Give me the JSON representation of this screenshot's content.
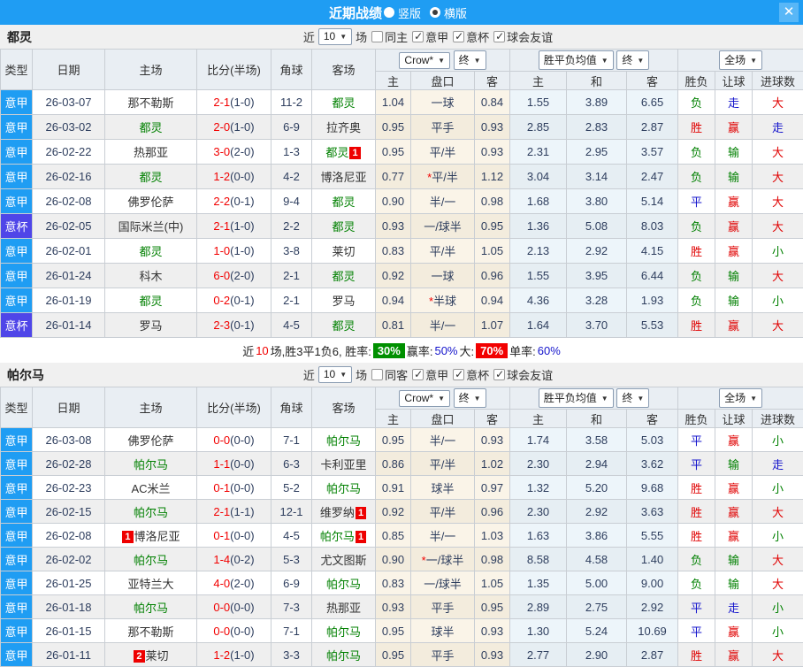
{
  "title_bar": {
    "title": "近期战绩",
    "radio_vertical": "竖版",
    "radio_horizontal": "横版",
    "close": "✕"
  },
  "columns": {
    "type": "类型",
    "date": "日期",
    "home": "主场",
    "score": "比分(半场)",
    "corner": "角球",
    "away": "客场",
    "odds_home": "主",
    "handicap": "盘口",
    "odds_away": "客",
    "mean_home": "主",
    "mean_draw": "和",
    "mean_away": "客",
    "result": "胜负",
    "let_ball": "让球",
    "goals": "进球数"
  },
  "sections": [
    {
      "team": "都灵",
      "filter": {
        "near": "近",
        "count": "10",
        "games": "场",
        "same": "同主",
        "checks": [
          "意甲",
          "意杯",
          "球会友谊"
        ]
      },
      "dropdowns": {
        "bookmaker": "Crow*",
        "final1": "终",
        "mean": "胜平负均值",
        "final2": "终",
        "scope": "全场"
      },
      "rows": [
        {
          "league": "意甲",
          "date": "26-03-07",
          "home": "那不勒斯",
          "home_green": false,
          "home_card": "",
          "score": "2-1",
          "half": "(1-0)",
          "corner": "11-2",
          "away": "都灵",
          "away_green": true,
          "away_card": "",
          "odds_home": "1.04",
          "handicap_star": "",
          "handicap": "一球",
          "odds_away": "0.84",
          "mean_home": "1.55",
          "mean_draw": "3.89",
          "mean_away": "6.65",
          "result": "负",
          "let_ball": "走",
          "goals": "大"
        },
        {
          "league": "意甲",
          "date": "26-03-02",
          "home": "都灵",
          "home_green": true,
          "home_card": "",
          "score": "2-0",
          "half": "(1-0)",
          "corner": "6-9",
          "away": "拉齐奥",
          "away_green": false,
          "away_card": "",
          "odds_home": "0.95",
          "handicap_star": "",
          "handicap": "平手",
          "odds_away": "0.93",
          "mean_home": "2.85",
          "mean_draw": "2.83",
          "mean_away": "2.87",
          "result": "胜",
          "let_ball": "赢",
          "goals": "走"
        },
        {
          "league": "意甲",
          "date": "26-02-22",
          "home": "热那亚",
          "home_green": false,
          "home_card": "",
          "score": "3-0",
          "half": "(2-0)",
          "corner": "1-3",
          "away": "都灵",
          "away_green": true,
          "away_card": "1",
          "odds_home": "0.95",
          "handicap_star": "",
          "handicap": "平/半",
          "odds_away": "0.93",
          "mean_home": "2.31",
          "mean_draw": "2.95",
          "mean_away": "3.57",
          "result": "负",
          "let_ball": "输",
          "goals": "大"
        },
        {
          "league": "意甲",
          "date": "26-02-16",
          "home": "都灵",
          "home_green": true,
          "home_card": "",
          "score": "1-2",
          "half": "(0-0)",
          "corner": "4-2",
          "away": "博洛尼亚",
          "away_green": false,
          "away_card": "",
          "odds_home": "0.77",
          "handicap_star": "*",
          "handicap": "平/半",
          "odds_away": "1.12",
          "mean_home": "3.04",
          "mean_draw": "3.14",
          "mean_away": "2.47",
          "result": "负",
          "let_ball": "输",
          "goals": "大"
        },
        {
          "league": "意甲",
          "date": "26-02-08",
          "home": "佛罗伦萨",
          "home_green": false,
          "home_card": "",
          "score": "2-2",
          "half": "(0-1)",
          "corner": "9-4",
          "away": "都灵",
          "away_green": true,
          "away_card": "",
          "odds_home": "0.90",
          "handicap_star": "",
          "handicap": "半/一",
          "odds_away": "0.98",
          "mean_home": "1.68",
          "mean_draw": "3.80",
          "mean_away": "5.14",
          "result": "平",
          "let_ball": "赢",
          "goals": "大"
        },
        {
          "league": "意杯",
          "date": "26-02-05",
          "home": "国际米兰(中)",
          "home_green": false,
          "home_card": "",
          "score": "2-1",
          "half": "(1-0)",
          "corner": "2-2",
          "away": "都灵",
          "away_green": true,
          "away_card": "",
          "odds_home": "0.93",
          "handicap_star": "",
          "handicap": "一/球半",
          "odds_away": "0.95",
          "mean_home": "1.36",
          "mean_draw": "5.08",
          "mean_away": "8.03",
          "result": "负",
          "let_ball": "赢",
          "goals": "大"
        },
        {
          "league": "意甲",
          "date": "26-02-01",
          "home": "都灵",
          "home_green": true,
          "home_card": "",
          "score": "1-0",
          "half": "(1-0)",
          "corner": "3-8",
          "away": "莱切",
          "away_green": false,
          "away_card": "",
          "odds_home": "0.83",
          "handicap_star": "",
          "handicap": "平/半",
          "odds_away": "1.05",
          "mean_home": "2.13",
          "mean_draw": "2.92",
          "mean_away": "4.15",
          "result": "胜",
          "let_ball": "赢",
          "goals": "小"
        },
        {
          "league": "意甲",
          "date": "26-01-24",
          "home": "科木",
          "home_green": false,
          "home_card": "",
          "score": "6-0",
          "half": "(2-0)",
          "corner": "2-1",
          "away": "都灵",
          "away_green": true,
          "away_card": "",
          "odds_home": "0.92",
          "handicap_star": "",
          "handicap": "一球",
          "odds_away": "0.96",
          "mean_home": "1.55",
          "mean_draw": "3.95",
          "mean_away": "6.44",
          "result": "负",
          "let_ball": "输",
          "goals": "大"
        },
        {
          "league": "意甲",
          "date": "26-01-19",
          "home": "都灵",
          "home_green": true,
          "home_card": "",
          "score": "0-2",
          "half": "(0-1)",
          "corner": "2-1",
          "away": "罗马",
          "away_green": false,
          "away_card": "",
          "odds_home": "0.94",
          "handicap_star": "*",
          "handicap": "半球",
          "odds_away": "0.94",
          "mean_home": "4.36",
          "mean_draw": "3.28",
          "mean_away": "1.93",
          "result": "负",
          "let_ball": "输",
          "goals": "小"
        },
        {
          "league": "意杯",
          "date": "26-01-14",
          "home": "罗马",
          "home_green": false,
          "home_card": "",
          "score": "2-3",
          "half": "(0-1)",
          "corner": "4-5",
          "away": "都灵",
          "away_green": true,
          "away_card": "",
          "odds_home": "0.81",
          "handicap_star": "",
          "handicap": "半/一",
          "odds_away": "1.07",
          "mean_home": "1.64",
          "mean_draw": "3.70",
          "mean_away": "5.53",
          "result": "胜",
          "let_ball": "赢",
          "goals": "大"
        }
      ],
      "summary": {
        "near": "近",
        "count": "10",
        "text": "场,胜3平1负6, 胜率:",
        "win_pct": "30%",
        "profit_label": "赢率:",
        "profit_pct": "50%",
        "big_label": "大:",
        "big_pct": "70%",
        "single_label": "单率:",
        "single_pct": "60%"
      }
    },
    {
      "team": "帕尔马",
      "filter": {
        "near": "近",
        "count": "10",
        "games": "场",
        "same": "同客",
        "checks": [
          "意甲",
          "意杯",
          "球会友谊"
        ]
      },
      "dropdowns": {
        "bookmaker": "Crow*",
        "final1": "终",
        "mean": "胜平负均值",
        "final2": "终",
        "scope": "全场"
      },
      "rows": [
        {
          "league": "意甲",
          "date": "26-03-08",
          "home": "佛罗伦萨",
          "home_green": false,
          "home_card": "",
          "score": "0-0",
          "half": "(0-0)",
          "corner": "7-1",
          "away": "帕尔马",
          "away_green": true,
          "away_card": "",
          "odds_home": "0.95",
          "handicap_star": "",
          "handicap": "半/一",
          "odds_away": "0.93",
          "mean_home": "1.74",
          "mean_draw": "3.58",
          "mean_away": "5.03",
          "result": "平",
          "let_ball": "赢",
          "goals": "小"
        },
        {
          "league": "意甲",
          "date": "26-02-28",
          "home": "帕尔马",
          "home_green": true,
          "home_card": "",
          "score": "1-1",
          "half": "(0-0)",
          "corner": "6-3",
          "away": "卡利亚里",
          "away_green": false,
          "away_card": "",
          "odds_home": "0.86",
          "handicap_star": "",
          "handicap": "平/半",
          "odds_away": "1.02",
          "mean_home": "2.30",
          "mean_draw": "2.94",
          "mean_away": "3.62",
          "result": "平",
          "let_ball": "输",
          "goals": "走"
        },
        {
          "league": "意甲",
          "date": "26-02-23",
          "home": "AC米兰",
          "home_green": false,
          "home_card": "",
          "score": "0-1",
          "half": "(0-0)",
          "corner": "5-2",
          "away": "帕尔马",
          "away_green": true,
          "away_card": "",
          "odds_home": "0.91",
          "handicap_star": "",
          "handicap": "球半",
          "odds_away": "0.97",
          "mean_home": "1.32",
          "mean_draw": "5.20",
          "mean_away": "9.68",
          "result": "胜",
          "let_ball": "赢",
          "goals": "小"
        },
        {
          "league": "意甲",
          "date": "26-02-15",
          "home": "帕尔马",
          "home_green": true,
          "home_card": "",
          "score": "2-1",
          "half": "(1-1)",
          "corner": "12-1",
          "away": "维罗纳",
          "away_green": false,
          "away_card": "1",
          "odds_home": "0.92",
          "handicap_star": "",
          "handicap": "平/半",
          "odds_away": "0.96",
          "mean_home": "2.30",
          "mean_draw": "2.92",
          "mean_away": "3.63",
          "result": "胜",
          "let_ball": "赢",
          "goals": "大"
        },
        {
          "league": "意甲",
          "date": "26-02-08",
          "home": "博洛尼亚",
          "home_green": false,
          "home_card": "1",
          "score": "0-1",
          "half": "(0-0)",
          "corner": "4-5",
          "away": "帕尔马",
          "away_green": true,
          "away_card": "1",
          "odds_home": "0.85",
          "handicap_star": "",
          "handicap": "半/一",
          "odds_away": "1.03",
          "mean_home": "1.63",
          "mean_draw": "3.86",
          "mean_away": "5.55",
          "result": "胜",
          "let_ball": "赢",
          "goals": "小"
        },
        {
          "league": "意甲",
          "date": "26-02-02",
          "home": "帕尔马",
          "home_green": true,
          "home_card": "",
          "score": "1-4",
          "half": "(0-2)",
          "corner": "5-3",
          "away": "尤文图斯",
          "away_green": false,
          "away_card": "",
          "odds_home": "0.90",
          "handicap_star": "*",
          "handicap": "一/球半",
          "odds_away": "0.98",
          "mean_home": "8.58",
          "mean_draw": "4.58",
          "mean_away": "1.40",
          "result": "负",
          "let_ball": "输",
          "goals": "大"
        },
        {
          "league": "意甲",
          "date": "26-01-25",
          "home": "亚特兰大",
          "home_green": false,
          "home_card": "",
          "score": "4-0",
          "half": "(2-0)",
          "corner": "6-9",
          "away": "帕尔马",
          "away_green": true,
          "away_card": "",
          "odds_home": "0.83",
          "handicap_star": "",
          "handicap": "一/球半",
          "odds_away": "1.05",
          "mean_home": "1.35",
          "mean_draw": "5.00",
          "mean_away": "9.00",
          "result": "负",
          "let_ball": "输",
          "goals": "大"
        },
        {
          "league": "意甲",
          "date": "26-01-18",
          "home": "帕尔马",
          "home_green": true,
          "home_card": "",
          "score": "0-0",
          "half": "(0-0)",
          "corner": "7-3",
          "away": "热那亚",
          "away_green": false,
          "away_card": "",
          "odds_home": "0.93",
          "handicap_star": "",
          "handicap": "平手",
          "odds_away": "0.95",
          "mean_home": "2.89",
          "mean_draw": "2.75",
          "mean_away": "2.92",
          "result": "平",
          "let_ball": "走",
          "goals": "小"
        },
        {
          "league": "意甲",
          "date": "26-01-15",
          "home": "那不勒斯",
          "home_green": false,
          "home_card": "",
          "score": "0-0",
          "half": "(0-0)",
          "corner": "7-1",
          "away": "帕尔马",
          "away_green": true,
          "away_card": "",
          "odds_home": "0.95",
          "handicap_star": "",
          "handicap": "球半",
          "odds_away": "0.93",
          "mean_home": "1.30",
          "mean_draw": "5.24",
          "mean_away": "10.69",
          "result": "平",
          "let_ball": "赢",
          "goals": "小"
        },
        {
          "league": "意甲",
          "date": "26-01-11",
          "home": "莱切",
          "home_green": false,
          "home_card": "2",
          "score": "1-2",
          "half": "(1-0)",
          "corner": "3-3",
          "away": "帕尔马",
          "away_green": true,
          "away_card": "",
          "odds_home": "0.95",
          "handicap_star": "",
          "handicap": "平手",
          "odds_away": "0.93",
          "mean_home": "2.77",
          "mean_draw": "2.90",
          "mean_away": "2.87",
          "result": "胜",
          "let_ball": "赢",
          "goals": "大"
        }
      ]
    }
  ]
}
